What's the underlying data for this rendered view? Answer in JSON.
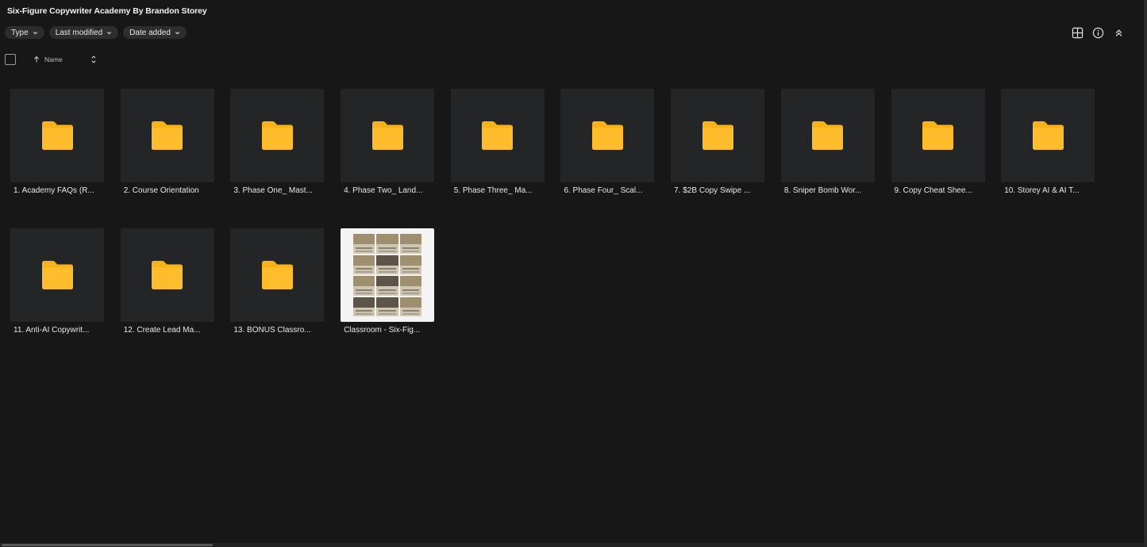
{
  "header": {
    "title": "Six-Figure Copywriter Academy By Brandon Storey"
  },
  "filters": [
    {
      "label": "Type",
      "icon": "chevron-down-icon"
    },
    {
      "label": "Last modified",
      "icon": "chevron-down-icon"
    },
    {
      "label": "Date added",
      "icon": "chevron-down-icon"
    }
  ],
  "toolbar": {
    "view_icon": "grid-view-icon",
    "info_icon": "info-icon",
    "collapse_icon": "double-chevron-up-icon"
  },
  "sort": {
    "column": "Name",
    "direction": "ascending"
  },
  "colors": {
    "folder": "#F9B21B",
    "background": "#171717",
    "tile": "#242526"
  },
  "items": [
    {
      "type": "folder",
      "label": "1. Academy FAQs (R..."
    },
    {
      "type": "folder",
      "label": "2. Course Orientation"
    },
    {
      "type": "folder",
      "label": "3. Phase One_ Mast..."
    },
    {
      "type": "folder",
      "label": "4. Phase Two_ Land..."
    },
    {
      "type": "folder",
      "label": "5. Phase Three_ Ma..."
    },
    {
      "type": "folder",
      "label": "6. Phase Four_ Scal..."
    },
    {
      "type": "folder",
      "label": "7. $2B Copy Swipe ..."
    },
    {
      "type": "folder",
      "label": "8. Sniper Bomb Wor..."
    },
    {
      "type": "folder",
      "label": "9. Copy Cheat Shee..."
    },
    {
      "type": "folder",
      "label": "10. Storey AI & AI T..."
    },
    {
      "type": "folder",
      "label": "11. Anti-AI Copywrit..."
    },
    {
      "type": "folder",
      "label": "12. Create Lead Ma..."
    },
    {
      "type": "folder",
      "label": "13. BONUS Classro..."
    },
    {
      "type": "file",
      "label": "Classroom - Six-Fig..."
    }
  ]
}
